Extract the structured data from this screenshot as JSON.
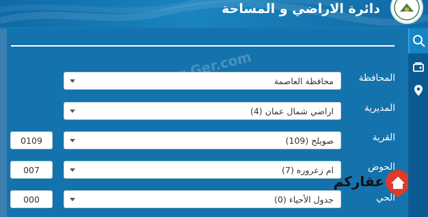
{
  "header": {
    "title": "دائرة الاراضي و المساحة"
  },
  "rail": {
    "items": [
      {
        "icon": "search-icon"
      },
      {
        "icon": "layers-icon"
      },
      {
        "icon": "map-pin-icon"
      }
    ]
  },
  "form": {
    "fields": [
      {
        "label": "المحافظة",
        "value": "محافظة العاصمة",
        "code": ""
      },
      {
        "label": "المديرية",
        "value": "اراضي شمال عمان (4)",
        "code": ""
      },
      {
        "label": "القرية",
        "value": "صويلح (109)",
        "code": "0109"
      },
      {
        "label": "الحوض",
        "value": "ام زعروره (7)",
        "code": "007"
      },
      {
        "label": "الحي",
        "value": "جدول الأحياء (0)",
        "code": "000"
      }
    ]
  },
  "watermark": "© www.Ger.com",
  "brand": {
    "name": "عقاركم",
    "accent": "#e03a2b"
  },
  "colors": {
    "panel": "#1473ad",
    "rail": "#0b5b92",
    "header": "#1578b2"
  }
}
